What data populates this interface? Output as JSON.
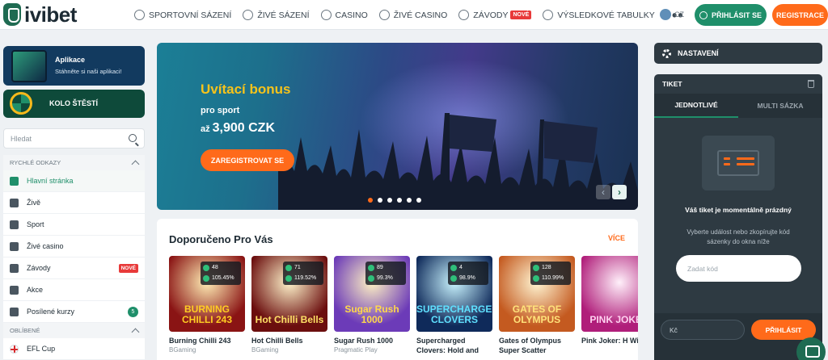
{
  "header": {
    "logo": "ivibet",
    "nav": [
      {
        "label": "SPORTOVNÍ SÁZENÍ",
        "icon": "soccer-ball-icon"
      },
      {
        "label": "ŽIVÉ SÁZENÍ",
        "icon": "stopwatch-icon"
      },
      {
        "label": "CASINO",
        "icon": "casino-chip-icon"
      },
      {
        "label": "ŽIVÉ CASINO",
        "icon": "shield-icon"
      },
      {
        "label": "ZÁVODY",
        "icon": "horse-icon",
        "badge": "NOVÉ"
      },
      {
        "label": "VÝSLEDKOVÉ TABULKY",
        "icon": "trophy-icon"
      }
    ],
    "more": "•••",
    "language": "CZ",
    "login": "PŘIHLÁSIT SE",
    "register": "REGISTRACE"
  },
  "sidebar": {
    "app_title": "Aplikace",
    "app_subtitle": "Stáhněte si naši aplikaci!",
    "wheel_label": "KOLO ŠTĚSTÍ",
    "search_placeholder": "Hledat",
    "quick_links_title": "RYCHLÉ ODKAZY",
    "items": [
      {
        "label": "Hlavní stránka",
        "icon": "home-icon"
      },
      {
        "label": "Živě",
        "icon": "live-signal-icon"
      },
      {
        "label": "Sport",
        "icon": "soccer-ball-icon"
      },
      {
        "label": "Živé casino",
        "icon": "casino-chip-icon"
      },
      {
        "label": "Závody",
        "icon": "horse-icon",
        "badge": "NOVÉ"
      },
      {
        "label": "Akce",
        "icon": "gift-icon"
      },
      {
        "label": "Posílené kurzy",
        "icon": "boost-icon",
        "count": "5"
      }
    ],
    "favorites_title": "OBLÍBENÉ",
    "favorites": [
      {
        "label": "EFL Cup",
        "icon": "england-flag-icon"
      }
    ]
  },
  "banner": {
    "title": "Uvítací bonus",
    "subtitle": "pro sport",
    "amount_prefix": "až",
    "amount": "3,900 CZK",
    "cta": "ZAREGISTROVAT SE",
    "slides": 6,
    "active_slide": 1
  },
  "recommended": {
    "title": "Doporučeno Pro Vás",
    "more": "VÍCE",
    "games": [
      {
        "name": "Burning Chilli 243",
        "provider": "BGaming",
        "players": "48",
        "rtp": "105.45%",
        "art": "BURNING CHILLI 243",
        "bg": "#8a1414",
        "fg": "#ffcc22"
      },
      {
        "name": "Hot Chilli Bells",
        "provider": "BGaming",
        "players": "71",
        "rtp": "119.52%",
        "art": "Hot Chilli Bells",
        "bg": "#6b0e0e",
        "fg": "#ffe066"
      },
      {
        "name": "Sugar Rush 1000",
        "provider": "Pragmatic Play",
        "players": "89",
        "rtp": "99.3%",
        "art": "Sugar Rush 1000",
        "bg": "#6c3bb8",
        "fg": "#ffd84a"
      },
      {
        "name": "Supercharged Clovers: Hold and",
        "provider": "",
        "players": "4",
        "rtp": "98.9%",
        "art": "SUPERCHARGED CLOVERS",
        "bg": "#0f2a5a",
        "fg": "#5fe0ff"
      },
      {
        "name": "Gates of Olympus Super Scatter",
        "provider": "",
        "players": "128",
        "rtp": "110.99%",
        "art": "GATES OF OLYMPUS",
        "bg": "#c45a20",
        "fg": "#ffe27a"
      },
      {
        "name": "Pink Joker: H Win",
        "provider": "",
        "players": "",
        "rtp": "",
        "art": "PINK JOKER",
        "bg": "#b01e7a",
        "fg": "#ffd2f0"
      }
    ]
  },
  "betslip": {
    "settings": "NASTAVENÍ",
    "title": "TIKET",
    "tabs": [
      "JEDNOTLIVÉ",
      "MULTI SÁZKA"
    ],
    "empty": "Váš tiket je momentálně prázdný",
    "hint": "Vyberte událost nebo zkopírujte kód sázenky do okna níže",
    "code_placeholder": "Zadat kód",
    "stake_placeholder": "Kč",
    "submit": "PŘIHLÁSIT"
  }
}
